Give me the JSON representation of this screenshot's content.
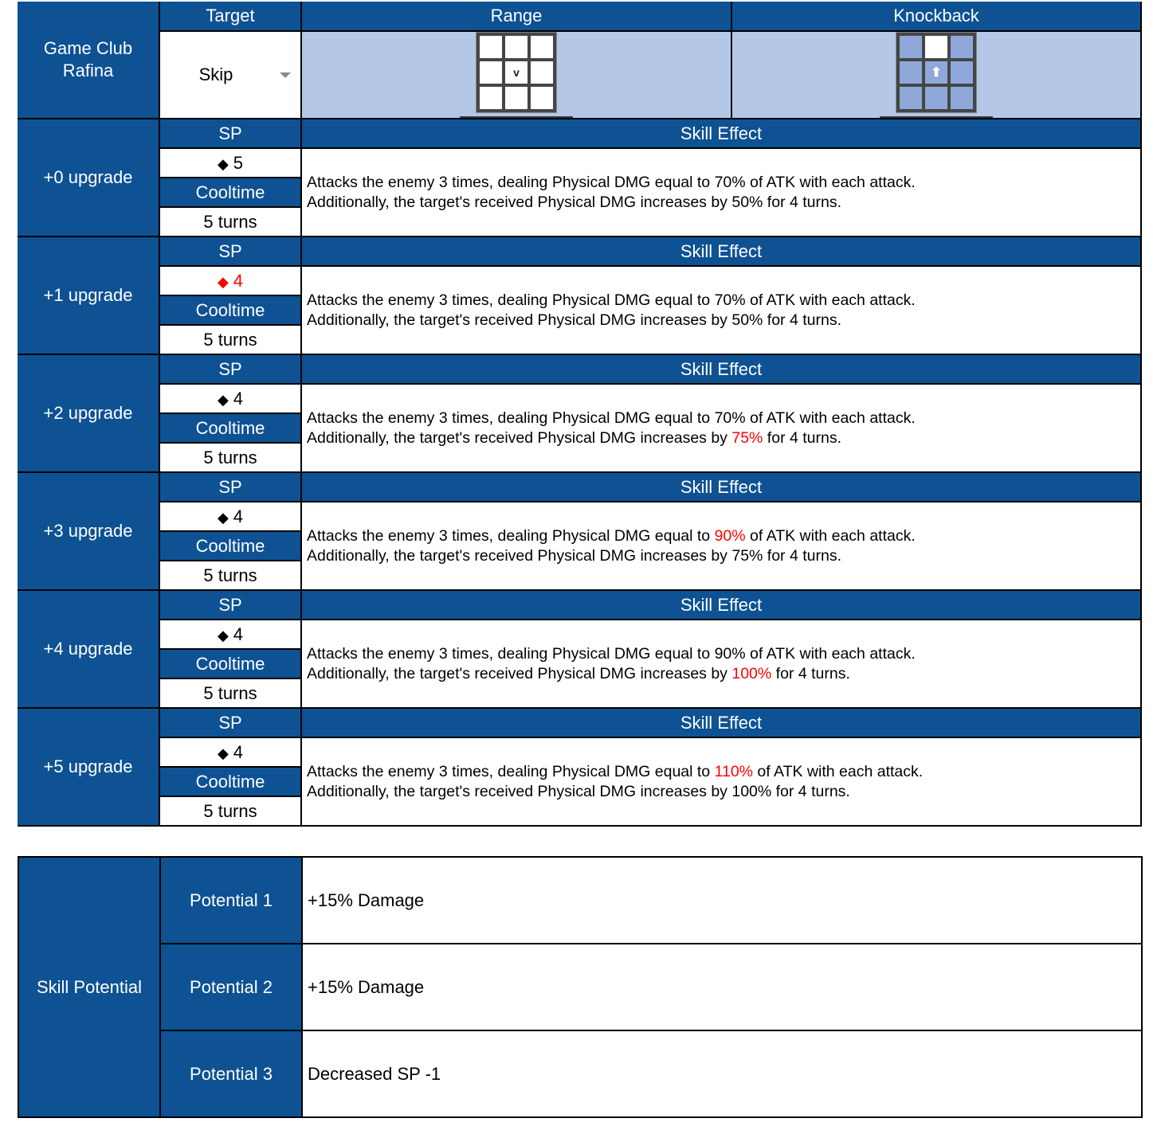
{
  "character": {
    "name_line1": "Game Club",
    "name_line2": "Rafina"
  },
  "header": {
    "target_label": "Target",
    "range_label": "Range",
    "knockback_label": "Knockback"
  },
  "target": {
    "selected": "Skip",
    "dropdown_icon": "chevron-down-icon"
  },
  "range_grid": {
    "center_marker": "v",
    "description": "3x3 grid, center cell marked as self"
  },
  "knockback_grid": {
    "direction": "up",
    "arrow_glyph": "⬆",
    "highlighted_cell": "top-center"
  },
  "labels": {
    "sp": "SP",
    "cooltime": "Cooltime",
    "skill_effect": "Skill Effect",
    "sp_icon": "◆"
  },
  "colors": {
    "header_blue": "#0e5294",
    "light_blue": "#b4c7e7",
    "highlight_red": "#ff0000"
  },
  "upgrades": [
    {
      "label": "+0 upgrade",
      "sp": "5",
      "sp_changed": false,
      "cooltime": "5 turns",
      "line1": [
        {
          "t": "Attacks the enemy 3 times, dealing Physical DMG equal to 70% of ATK with each attack."
        }
      ],
      "line2": [
        {
          "t": "Additionally, the target's received Physical DMG increases by 50% for 4 turns."
        }
      ]
    },
    {
      "label": "+1 upgrade",
      "sp": "4",
      "sp_changed": true,
      "cooltime": "5 turns",
      "line1": [
        {
          "t": "Attacks the enemy 3 times, dealing Physical DMG equal to 70% of ATK with each attack."
        }
      ],
      "line2": [
        {
          "t": "Additionally, the target's received Physical DMG increases by 50% for 4 turns."
        }
      ]
    },
    {
      "label": "+2 upgrade",
      "sp": "4",
      "sp_changed": false,
      "cooltime": "5 turns",
      "line1": [
        {
          "t": "Attacks the enemy 3 times, dealing Physical DMG equal to 70% of ATK with each attack."
        }
      ],
      "line2": [
        {
          "t": "Additionally, the target's received Physical DMG increases by "
        },
        {
          "t": "75%",
          "red": true
        },
        {
          "t": " for 4 turns."
        }
      ]
    },
    {
      "label": "+3 upgrade",
      "sp": "4",
      "sp_changed": false,
      "cooltime": "5 turns",
      "line1": [
        {
          "t": "Attacks the enemy 3 times, dealing Physical DMG equal to "
        },
        {
          "t": "90%",
          "red": true
        },
        {
          "t": " of ATK with each attack."
        }
      ],
      "line2": [
        {
          "t": "Additionally, the target's received Physical DMG increases by 75% for 4 turns."
        }
      ]
    },
    {
      "label": "+4 upgrade",
      "sp": "4",
      "sp_changed": false,
      "cooltime": "5 turns",
      "line1": [
        {
          "t": "Attacks the enemy 3 times, dealing Physical DMG equal to 90% of ATK with each attack."
        }
      ],
      "line2": [
        {
          "t": "Additionally, the target's received Physical DMG increases by "
        },
        {
          "t": "100%",
          "red": true
        },
        {
          "t": " for 4 turns."
        }
      ]
    },
    {
      "label": "+5 upgrade",
      "sp": "4",
      "sp_changed": false,
      "cooltime": "5 turns",
      "line1": [
        {
          "t": "Attacks the enemy 3 times, dealing Physical DMG equal to "
        },
        {
          "t": "110%",
          "red": true
        },
        {
          "t": " of ATK with each attack."
        }
      ],
      "line2": [
        {
          "t": "Additionally, the target's received Physical DMG increases by 100% for 4 turns."
        }
      ]
    }
  ],
  "potential": {
    "title": "Skill Potential",
    "items": [
      {
        "label": "Potential 1",
        "value": "+15% Damage"
      },
      {
        "label": "Potential 2",
        "value": "+15% Damage"
      },
      {
        "label": "Potential 3",
        "value": "Decreased SP -1"
      }
    ]
  }
}
